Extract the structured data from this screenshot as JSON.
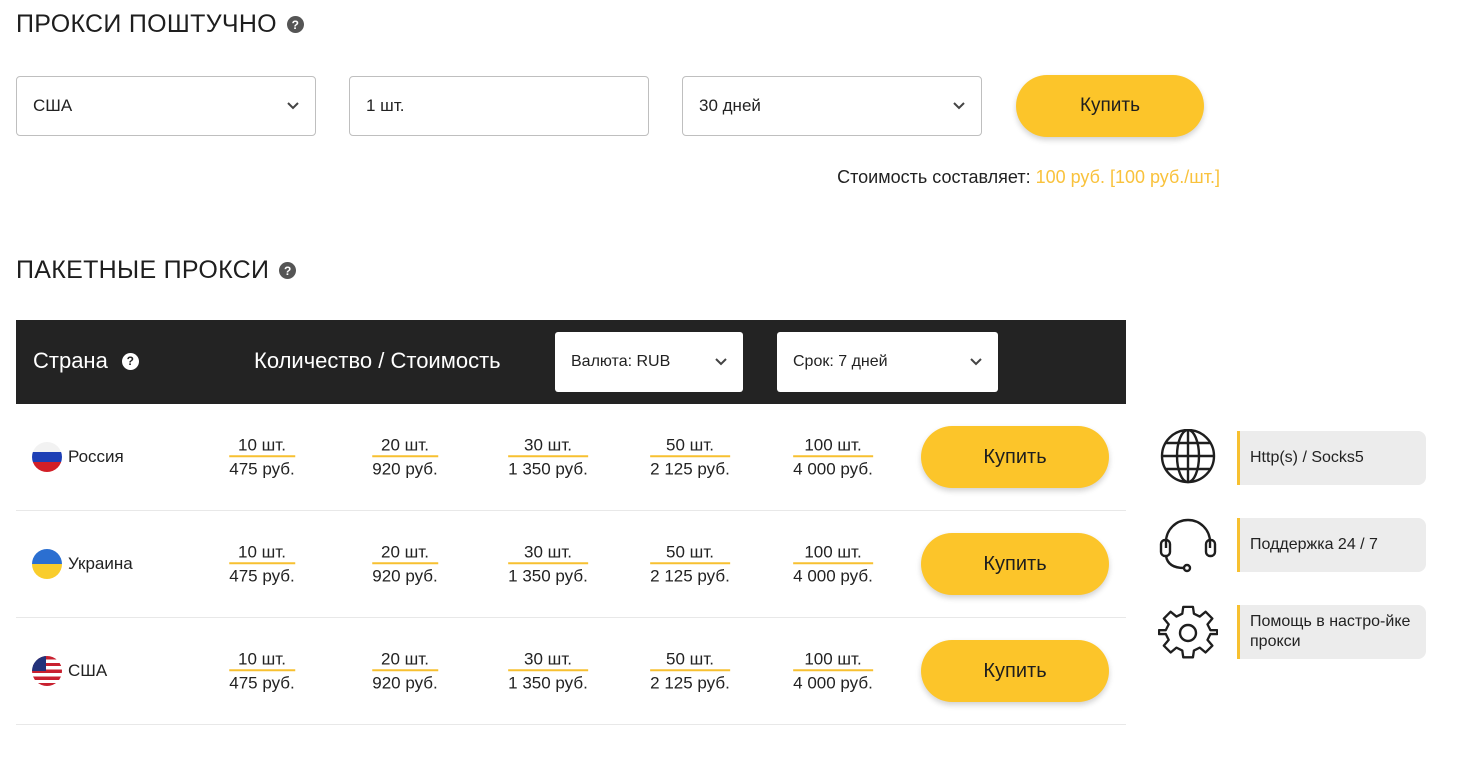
{
  "single": {
    "title": "ПРОКСИ ПОШТУЧНО",
    "country_value": "США",
    "quantity_value": "1 шт.",
    "period_value": "30 дней",
    "buy_label": "Купить",
    "cost_prefix": "Стоимость составляет:",
    "cost_value": "100 руб. [100 руб./шт.]"
  },
  "packages": {
    "title": "ПАКЕТНЫЕ ПРОКСИ",
    "header": {
      "country_label": "Страна",
      "qty_cost_label": "Количество / Стоимость",
      "currency_select": "Валюта: RUB",
      "term_select": "Срок: 7 дней"
    },
    "rows": [
      {
        "country": "Россия",
        "buy_label": "Купить",
        "cells": [
          {
            "qty": "10 шт.",
            "price": "475 руб."
          },
          {
            "qty": "20 шт.",
            "price": "920 руб."
          },
          {
            "qty": "30 шт.",
            "price": "1 350 руб."
          },
          {
            "qty": "50 шт.",
            "price": "2 125 руб."
          },
          {
            "qty": "100 шт.",
            "price": "4 000 руб."
          }
        ]
      },
      {
        "country": "Украина",
        "buy_label": "Купить",
        "cells": [
          {
            "qty": "10 шт.",
            "price": "475 руб."
          },
          {
            "qty": "20 шт.",
            "price": "920 руб."
          },
          {
            "qty": "30 шт.",
            "price": "1 350 руб."
          },
          {
            "qty": "50 шт.",
            "price": "2 125 руб."
          },
          {
            "qty": "100 шт.",
            "price": "4 000 руб."
          }
        ]
      },
      {
        "country": "США",
        "buy_label": "Купить",
        "cells": [
          {
            "qty": "10 шт.",
            "price": "475 руб."
          },
          {
            "qty": "20 шт.",
            "price": "920 руб."
          },
          {
            "qty": "30 шт.",
            "price": "1 350 руб."
          },
          {
            "qty": "50 шт.",
            "price": "2 125 руб."
          },
          {
            "qty": "100 шт.",
            "price": "4 000 руб."
          }
        ]
      }
    ]
  },
  "features": [
    {
      "icon": "globe-icon",
      "label": "Http(s) / Socks5"
    },
    {
      "icon": "headset-icon",
      "label": "Поддержка 24 / 7"
    },
    {
      "icon": "gear-icon",
      "label": "Помощь в настро-йке прокси"
    }
  ],
  "colors": {
    "accent": "#fcc52a",
    "price_text": "#f9c23c",
    "table_header": "#232323",
    "feature_box": "#ececec"
  }
}
